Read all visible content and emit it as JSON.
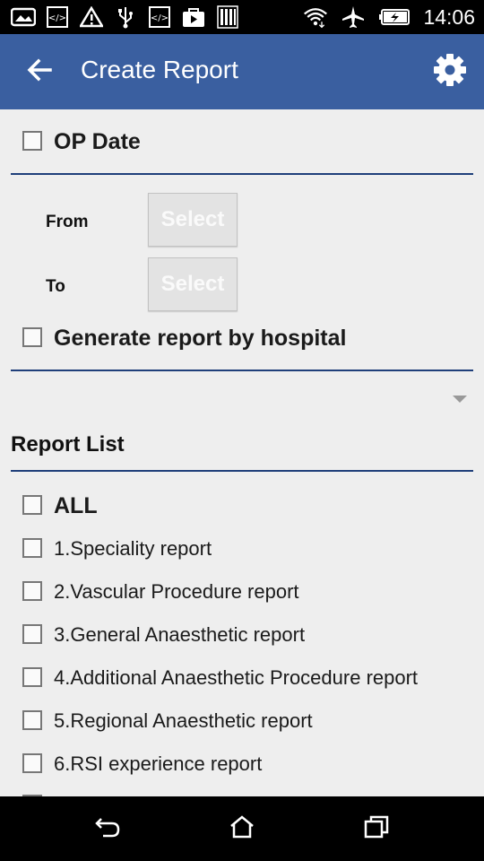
{
  "status_bar": {
    "left_icons": [
      "image-icon",
      "code-icon",
      "warning-icon",
      "usb-icon",
      "code-icon",
      "play-bag-icon",
      "barcode-icon"
    ],
    "right_icons": [
      "wifi-icon",
      "airplane-icon",
      "battery-charging-icon"
    ],
    "time": "14:06"
  },
  "app_bar": {
    "title": "Create Report",
    "back_icon": "arrow-left-icon",
    "settings_icon": "gear-icon"
  },
  "op_date": {
    "label": "OP Date",
    "checked": false
  },
  "date_range": {
    "from_label": "From",
    "from_button": "Select",
    "to_label": "To",
    "to_button": "Select"
  },
  "hospital": {
    "label": "Generate report by hospital",
    "checked": false
  },
  "report_list": {
    "title": "Report List",
    "all_label": "ALL",
    "items": [
      "1.Speciality report",
      "2.Vascular Procedure report",
      "3.General Anaesthetic report",
      "4.Additional Anaesthetic Procedure report",
      "5.Regional Anaesthetic report",
      "6.RSI experience report"
    ]
  },
  "nav_bar": {
    "back_icon": "nav-back-icon",
    "home_icon": "nav-home-icon",
    "recents_icon": "nav-recents-icon"
  },
  "colors": {
    "app_bar": "#3a5fa0",
    "divider": "#1f3f7a",
    "background": "#eeeeee"
  }
}
